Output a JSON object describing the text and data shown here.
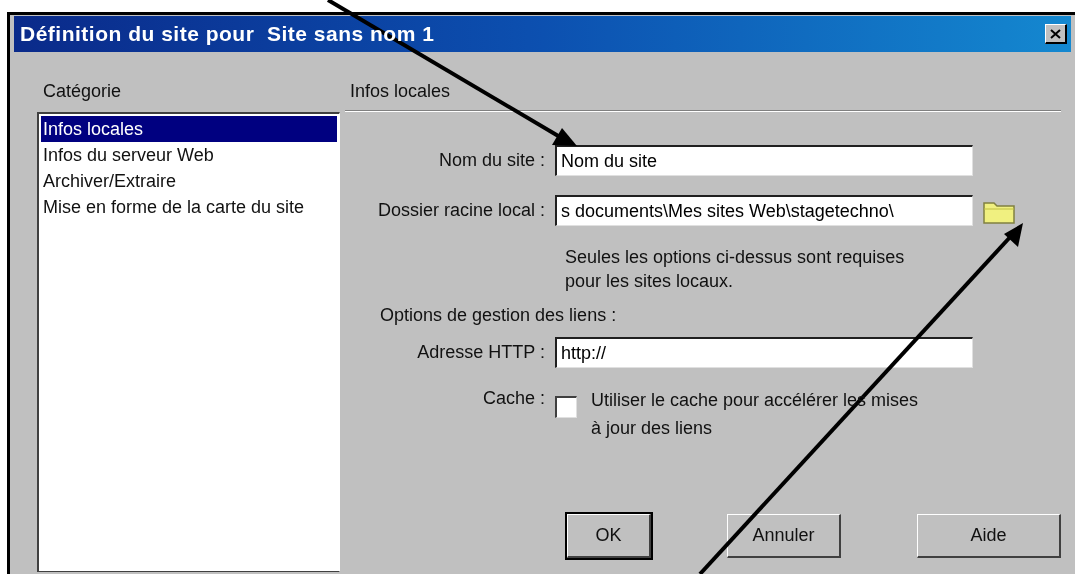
{
  "window": {
    "title": "Définition du site pour  Site sans nom 1"
  },
  "category_label": "Catégorie",
  "categories": [
    {
      "label": "Infos locales",
      "selected": true
    },
    {
      "label": "Infos du serveur Web",
      "selected": false
    },
    {
      "label": "Archiver/Extraire",
      "selected": false
    },
    {
      "label": "Mise en forme de la carte du site",
      "selected": false
    }
  ],
  "section_title": "Infos locales",
  "fields": [
    {
      "kind": "text",
      "label": "Nom du site :",
      "value": "Nom du site"
    },
    {
      "kind": "folder",
      "label": "Dossier racine local :",
      "value": "s documents\\Mes sites Web\\stagetechno\\"
    }
  ],
  "note": "Seules les options ci-dessus sont requises pour les sites locaux.",
  "link_options_label": "Options de gestion des liens :",
  "http_field": {
    "label": "Adresse HTTP :",
    "value": "http://"
  },
  "cache": {
    "label": "Cache :",
    "text": "Utiliser le cache pour accélérer les mises à jour des liens",
    "checked": false
  },
  "buttons": [
    {
      "label": "OK",
      "default": true
    },
    {
      "label": "Annuler",
      "default": false
    },
    {
      "label": "Aide",
      "default": false
    }
  ]
}
